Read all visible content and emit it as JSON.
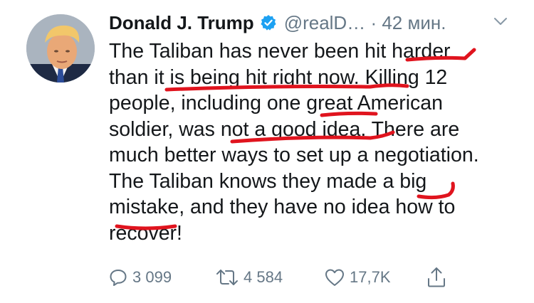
{
  "author": {
    "name": "Donald J. Trump",
    "handle": "@realD…",
    "time": "· 42 мин."
  },
  "tweet": {
    "lines": [
      "The Taliban has never been hit harder",
      "than it is being hit right now. Killing 12",
      "people, including one great American",
      "soldier, was not a good idea. There are",
      "much better ways to set up a negotiation.",
      "The Taliban knows they made a big",
      "mistake, and they have no idea how to",
      "recover!"
    ]
  },
  "actions": {
    "replies": "3 099",
    "retweets": "4 584",
    "likes": "17,7K"
  },
  "colors": {
    "text": "#14171a",
    "muted": "#657786",
    "verified": "#1da1f2",
    "scribble": "#e0141e"
  },
  "icons": [
    "verified-badge-icon",
    "chevron-down-icon",
    "reply-icon",
    "retweet-icon",
    "like-icon",
    "share-icon"
  ]
}
